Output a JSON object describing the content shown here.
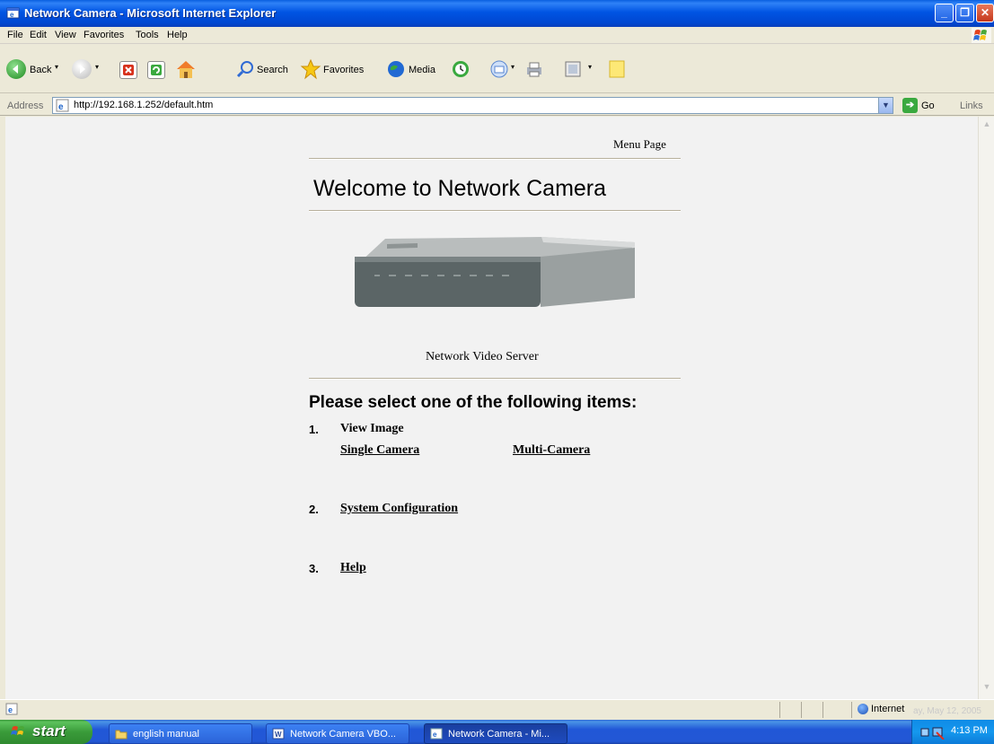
{
  "window": {
    "title": "Network Camera - Microsoft Internet Explorer",
    "controls": [
      "minimize",
      "restore",
      "close"
    ]
  },
  "menubar": {
    "items": [
      "File",
      "Edit",
      "View",
      "Favorites",
      "Tools",
      "Help"
    ]
  },
  "toolbar": {
    "back_label": "Back",
    "search_label": "Search",
    "favorites_label": "Favorites",
    "media_label": "Media"
  },
  "address": {
    "label": "Address",
    "url": "http://192.168.1.252/default.htm",
    "go_label": "Go",
    "links_label": "Links"
  },
  "page": {
    "menu_page": "Menu Page",
    "welcome": "Welcome to Network Camera",
    "device_caption": "Network Video Server",
    "prompt": "Please select one of the following items:",
    "items": [
      {
        "number": "1.",
        "label": "View Image",
        "links": [
          "Single Camera",
          "Multi-Camera"
        ]
      },
      {
        "number": "2.",
        "label": "System Configuration"
      },
      {
        "number": "3.",
        "label": "Help"
      }
    ]
  },
  "statusbar": {
    "zone": "Internet",
    "faded_date": "ay, May 12, 2005"
  },
  "taskbar": {
    "start_label": "start",
    "tasks": [
      "english manual",
      "Network Camera VBO...",
      "Network Camera - Mi..."
    ],
    "time": "4:13 PM"
  },
  "colors": {
    "titlebar_blue": "#0054e3",
    "page_background": "#f2f2f2",
    "taskbar_blue": "#2157d7",
    "start_green": "#3a9b3a"
  }
}
